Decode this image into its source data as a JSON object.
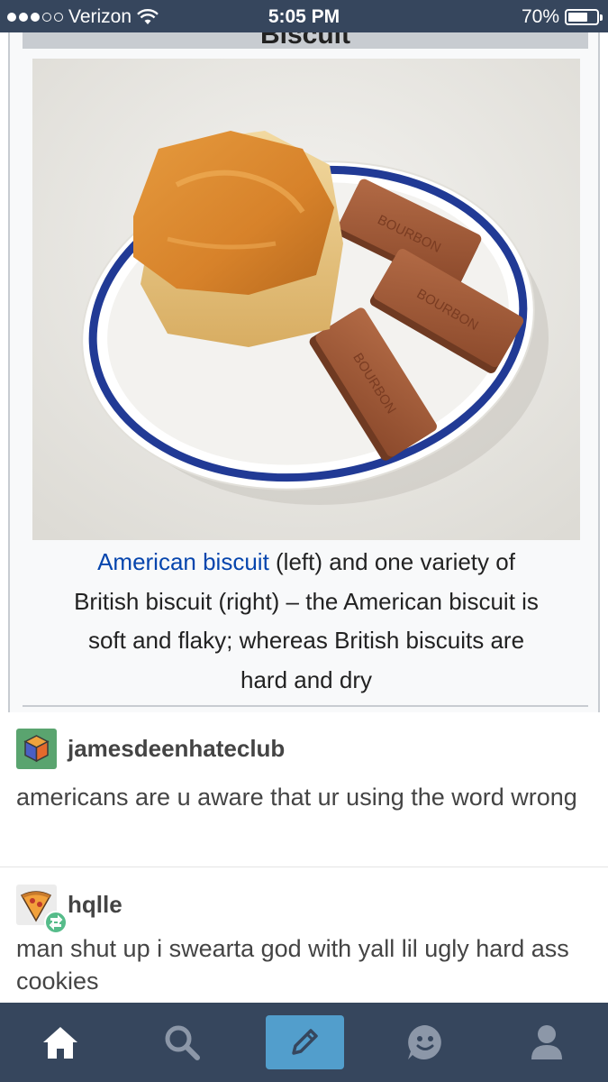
{
  "status_bar": {
    "carrier": "Verizon",
    "time": "5:05 PM",
    "battery": "70%",
    "battery_level": 0.7,
    "signal_bars": 3
  },
  "wiki": {
    "title": "Biscuit",
    "caption_link": "American biscuit",
    "caption_line1_rest": " (left) and one variety of",
    "caption_line2": "British biscuit (right) – the American biscuit is",
    "caption_line3": "soft and flaky; whereas British biscuits are",
    "caption_line4": "hard and dry"
  },
  "posts": [
    {
      "username": "jamesdeenhateclub",
      "text": "americans are u aware that ur using the word wrong"
    },
    {
      "username": "hqlle",
      "text": "man shut up i swearta god with yall lil ugly hard ass cookies"
    }
  ],
  "tab_bar": {
    "items": [
      "home-icon",
      "search-icon",
      "compose-icon",
      "activity-icon",
      "account-icon"
    ],
    "active": "home",
    "accent": "#529ecc",
    "background": "#36465d"
  }
}
